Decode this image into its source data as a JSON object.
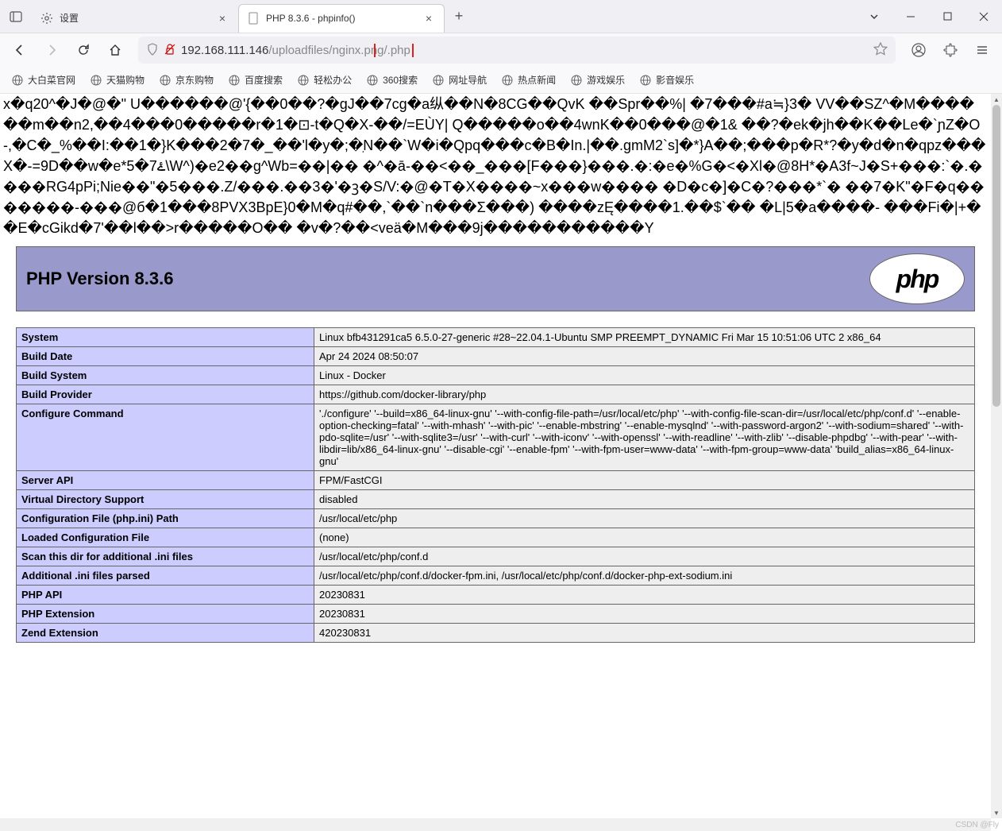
{
  "tabs": [
    {
      "title": "设置",
      "icon": "gear"
    },
    {
      "title": "PHP 8.3.6 - phpinfo()",
      "icon": "page"
    }
  ],
  "url": {
    "host": "192.168.111.146",
    "path_before": "/uploadfiles/nginx.pn",
    "path_highlight": "g/.php"
  },
  "bookmarks": [
    {
      "label": "大白菜官网"
    },
    {
      "label": "天猫购物"
    },
    {
      "label": "京东购物"
    },
    {
      "label": "百度搜索"
    },
    {
      "label": "轻松办公"
    },
    {
      "label": "360搜索"
    },
    {
      "label": "网址导航"
    },
    {
      "label": "热点新闻"
    },
    {
      "label": "游戏娱乐"
    },
    {
      "label": "影音娱乐"
    }
  ],
  "garbage_text": "x�q20^�J�@�\" U������@'{��0��?�gJ��7cg�a纵��N�8CG��QvK ��Spr��%| �7���#a≒}3� VV��SZ^�M������m��n2,��4���0�����r�1�⊡-t�Q�X-��/=EÙY| Q�����o��4wnK��0���@�1& ��?�ek�jh��K��Le�`ɲZ�O-,�C�_%��I:��1�}K���2�7�_��'l�y�;�ֽN��`W�i�Qpq���c�B�In.|��.gmM2`s]�*}A��;���p�R*?�y�d�n�qpz���X�-=9D��w�e*5�7ۓ\\W^)�e2��g^Wb=��|�� �^�ā-��<��_���[F���}���.�:�e�%G�<�Xl�@8H*�A3f~J�S+���:`�.����RG4pPi;Nie��\"�5���.Z/���.��3�'�ꝫ�S/V:�@�T�X����~x���w���� �D�c�]�C�?���*`� ��7�K\"�F�q�������-���@б�1���8PVX3BpE}0�M�q#��,`��`n���Σ���) ����zĘ����1.��$`�� �L|5�a����- ���Fi�|+��E�cGikd�7'��l��>r�����O�� �v�?��<veä�M���9j�����������Y",
  "php": {
    "version_label": "PHP Version 8.3.6",
    "logo_text": "php"
  },
  "info_rows": [
    {
      "k": "System",
      "v": "Linux bfb431291ca5 6.5.0-27-generic #28~22.04.1-Ubuntu SMP PREEMPT_DYNAMIC Fri Mar 15 10:51:06 UTC 2 x86_64"
    },
    {
      "k": "Build Date",
      "v": "Apr 24 2024 08:50:07"
    },
    {
      "k": "Build System",
      "v": "Linux - Docker"
    },
    {
      "k": "Build Provider",
      "v": "https://github.com/docker-library/php"
    },
    {
      "k": "Configure Command",
      "v": "'./configure' '--build=x86_64-linux-gnu' '--with-config-file-path=/usr/local/etc/php' '--with-config-file-scan-dir=/usr/local/etc/php/conf.d' '--enable-option-checking=fatal' '--with-mhash' '--with-pic' '--enable-mbstring' '--enable-mysqlnd' '--with-password-argon2' '--with-sodium=shared' '--with-pdo-sqlite=/usr' '--with-sqlite3=/usr' '--with-curl' '--with-iconv' '--with-openssl' '--with-readline' '--with-zlib' '--disable-phpdbg' '--with-pear' '--with-libdir=lib/x86_64-linux-gnu' '--disable-cgi' '--enable-fpm' '--with-fpm-user=www-data' '--with-fpm-group=www-data' 'build_alias=x86_64-linux-gnu'"
    },
    {
      "k": "Server API",
      "v": "FPM/FastCGI"
    },
    {
      "k": "Virtual Directory Support",
      "v": "disabled"
    },
    {
      "k": "Configuration File (php.ini) Path",
      "v": "/usr/local/etc/php"
    },
    {
      "k": "Loaded Configuration File",
      "v": "(none)"
    },
    {
      "k": "Scan this dir for additional .ini files",
      "v": "/usr/local/etc/php/conf.d"
    },
    {
      "k": "Additional .ini files parsed",
      "v": "/usr/local/etc/php/conf.d/docker-fpm.ini, /usr/local/etc/php/conf.d/docker-php-ext-sodium.ini"
    },
    {
      "k": "PHP API",
      "v": "20230831"
    },
    {
      "k": "PHP Extension",
      "v": "20230831"
    },
    {
      "k": "Zend Extension",
      "v": "420230831"
    }
  ],
  "watermark": "CSDN @Fly"
}
